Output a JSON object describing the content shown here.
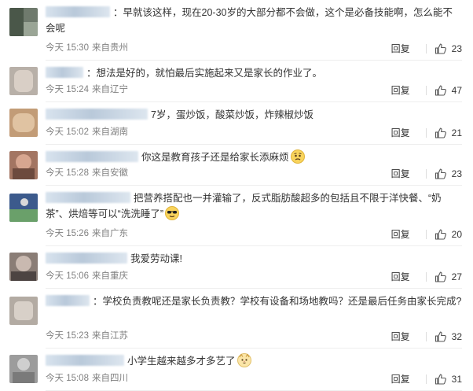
{
  "comments": [
    {
      "text": "：早就该这样，现在20-30岁的大部分都不会做，这个是必备技能啊，怎么能不会呢",
      "time": "今天 15:30",
      "location": "来自贵州",
      "reply": "回复",
      "likes": "23"
    },
    {
      "text": "：想法是好的，就怕最后实施起来又是家长的作业了。",
      "time": "今天 15:24",
      "location": "来自辽宁",
      "reply": "回复",
      "likes": "47"
    },
    {
      "text": "7岁，蛋炒饭，酸菜炒饭，炸辣椒炒饭",
      "time": "今天 15:02",
      "location": "来自湖南",
      "reply": "回复",
      "likes": "21"
    },
    {
      "text": "你这是教育孩子还是给家长添麻烦",
      "emoji": "worried-face",
      "time": "今天 15:28",
      "location": "来自安徽",
      "reply": "回复",
      "likes": "23"
    },
    {
      "text": "把营养搭配也一并灌输了，反式脂肪酸超多的包括且不限于洋快餐、“奶茶”、烘焙等可以“洗洗睡了”",
      "emoji": "sunglasses-face",
      "time": "今天 15:26",
      "location": "来自广东",
      "reply": "回复",
      "likes": "20"
    },
    {
      "text": "我爱劳动课!",
      "time": "今天 15:06",
      "location": "来自重庆",
      "reply": "回复",
      "likes": "27"
    },
    {
      "text": "：学校负责教呢还是家长负责教？学校有设备和场地教吗？还是最后任务由家长完成?",
      "time": "今天 15:23",
      "location": "来自江苏",
      "reply": "回复",
      "likes": "32"
    },
    {
      "text": "小学生越来越多才多艺了",
      "emoji": "cat-face",
      "time": "今天 15:08",
      "location": "来自四川",
      "reply": "回复",
      "likes": "31"
    }
  ],
  "colors": {
    "text": "#333333",
    "meta": "#808080",
    "divider": "#eeeeee",
    "blurred_name": "#c9d7e6"
  }
}
